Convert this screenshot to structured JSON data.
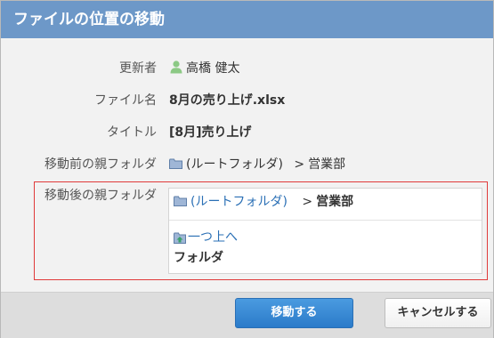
{
  "dialog": {
    "title": "ファイルの位置の移動"
  },
  "fields": {
    "updater": {
      "label": "更新者",
      "value": "高橋 健太",
      "icon": "user-icon"
    },
    "file_name": {
      "label": "ファイル名",
      "value": "8月の売り上げ.xlsx"
    },
    "title": {
      "label": "タイトル",
      "value": "[8月]売り上げ"
    },
    "source_folder": {
      "label": "移動前の親フォルダ",
      "root": "(ルートフォルダ)",
      "separator": ">",
      "folder": "営業部",
      "icon": "folder-icon"
    }
  },
  "destination": {
    "label": "移動後の親フォルダ",
    "path_root": "(ルートフォルダ)",
    "separator": ">",
    "path_current": "営業部",
    "up_link": "一つ上へ",
    "folder_heading": "フォルダ"
  },
  "buttons": {
    "move": "移動する",
    "cancel": "キャンセルする"
  },
  "colors": {
    "title_bar": "#6d98c8",
    "link": "#2a6fb5",
    "primary_button": "#2b7bc9",
    "highlight_border": "#e03a3a"
  }
}
